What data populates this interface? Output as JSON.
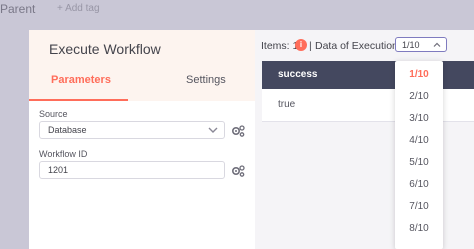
{
  "topbar": {
    "parent_label": "Parent",
    "add_tag_label": "+ Add tag"
  },
  "node": {
    "title": "Execute Workflow",
    "tabs": [
      {
        "label": "Parameters",
        "active": true
      },
      {
        "label": "Settings",
        "active": false
      }
    ],
    "fields": {
      "source": {
        "label": "Source",
        "value": "Database"
      },
      "workflow_id": {
        "label": "Workflow ID",
        "value": "1201"
      }
    }
  },
  "output": {
    "items_label": "Items: 1",
    "info_icon": "i",
    "separator": "|",
    "execution_label": "Data of Execution:",
    "execution_selected": "1/10",
    "table": {
      "columns": [
        "success"
      ],
      "rows": [
        [
          "true"
        ]
      ]
    },
    "execution_options": [
      "1/10",
      "2/10",
      "3/10",
      "4/10",
      "5/10",
      "6/10",
      "7/10",
      "8/10"
    ]
  },
  "colors": {
    "accent": "#ff6d5a",
    "header_dark": "#44485f",
    "canvas_bg": "#c9c7d6",
    "select_border": "#7f7bbf"
  },
  "icons": {
    "select_chevron": "chevron-down-icon",
    "exec_chevron": "chevron-up-icon",
    "gears": "gears-icon",
    "info": "info-icon"
  }
}
